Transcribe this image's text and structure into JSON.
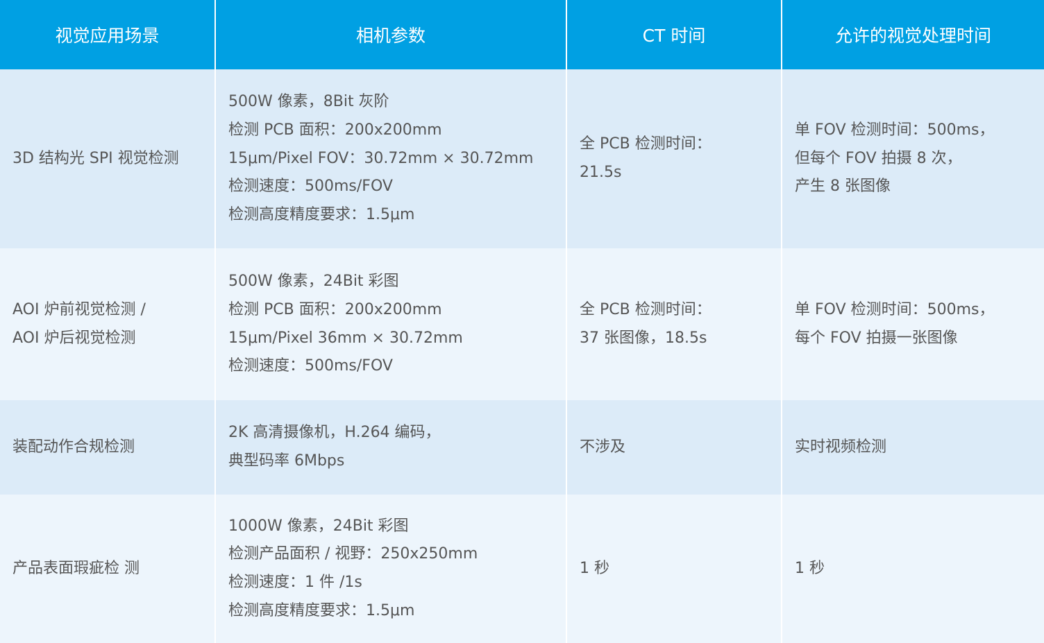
{
  "table": {
    "headers": [
      "视觉应用场景",
      "相机参数",
      "CT 时间",
      "允许的视觉处理时间"
    ],
    "rows": [
      {
        "scene": [
          "3D 结构光 SPI 视觉检测"
        ],
        "camera": [
          "500W 像素，8Bit 灰阶",
          "检测 PCB 面积：200x200mm",
          "15μm/Pixel FOV：30.72mm × 30.72mm",
          "检测速度：500ms/FOV",
          "检测高度精度要求：1.5μm"
        ],
        "ct": [
          "全 PCB 检测时间：",
          "21.5s"
        ],
        "allowed": [
          "单 FOV 检测时间：500ms，",
          "但每个 FOV 拍摄 8 次，",
          "产生 8 张图像"
        ]
      },
      {
        "scene": [
          "AOI 炉前视觉检测 /",
          "AOI 炉后视觉检测"
        ],
        "camera": [
          "500W 像素，24Bit 彩图",
          "检测 PCB 面积：200x200mm",
          "15μm/Pixel   36mm × 30.72mm",
          "检测速度：500ms/FOV"
        ],
        "ct": [
          "全 PCB 检测时间：",
          "37 张图像，18.5s"
        ],
        "allowed": [
          "单 FOV 检测时间：500ms，",
          "每个 FOV 拍摄一张图像"
        ]
      },
      {
        "scene": [
          "装配动作合规检测"
        ],
        "camera": [
          "2K 高清摄像机，H.264 编码，",
          "典型码率 6Mbps"
        ],
        "ct": [
          "不涉及"
        ],
        "allowed": [
          "实时视频检测"
        ]
      },
      {
        "scene": [
          "产品表面瑕疵检 测"
        ],
        "camera": [
          "1000W 像素，24Bit 彩图",
          "检测产品面积 / 视野：250x250mm",
          "检测速度：1 件 /1s",
          "检测高度精度要求：1.5μm"
        ],
        "ct": [
          "1 秒"
        ],
        "allowed": [
          "1 秒"
        ]
      }
    ]
  }
}
